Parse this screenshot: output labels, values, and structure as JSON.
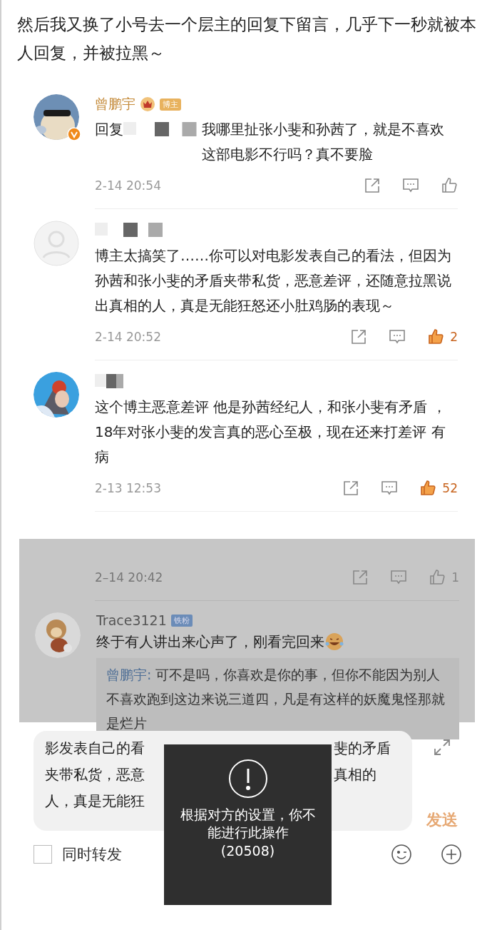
{
  "intro": "然后我又换了小号去一个层主的回复下留言，几乎下一秒就被本人回复，并被拉黑～",
  "screenshot_1": {
    "comments": [
      {
        "author": "曾鹏宇",
        "verified": true,
        "badge": "博主",
        "reply_prefix": "回复",
        "text": "我哪里扯张小斐和孙茜了，就是不喜欢这部电影不行吗？真不要脸",
        "time": "2-14 20:54",
        "liked": false
      },
      {
        "text": "博主太搞笑了……你可以对电影发表自己的看法，但因为孙茜和张小斐的矛盾夹带私货，恶意差评，还随意拉黑说出真相的人，真是无能狂怒还小肚鸡肠的表现～",
        "time": "2-14 20:52",
        "liked": true,
        "likes": "2"
      },
      {
        "text": "这个博主恶意差评 他是孙茜经纪人，和张小斐有矛盾 ，18年对张小斐的发言真的恶心至极，现在还来打差评 有病",
        "time": "2-13 12:53",
        "liked": true,
        "likes": "52"
      }
    ]
  },
  "screenshot_2": {
    "partial_comment": {
      "time": "2–14 20:42",
      "liked": false,
      "likes": "1"
    },
    "comment": {
      "author": "Trace3121",
      "badge": "铁粉",
      "text": "终于有人讲出来心声了，刚看完回来",
      "reply": {
        "author": "曾鹏宇:",
        "text": "可不是吗，你喜欢是你的事，但你不能因为别人不喜欢跑到这边来说三道四，凡是有这样的妖魔鬼怪那就是烂片"
      }
    },
    "composer": {
      "lines": [
        {
          "left": "影发表自己的看",
          "right": "斐的矛盾"
        },
        {
          "left": "夹带私货，恶意",
          "right": "真相的"
        },
        {
          "left": "人，真是无能狂"
        }
      ],
      "send": "发送",
      "forward": {
        "label": "同时转发",
        "checked": false
      }
    },
    "toast": {
      "message": "根据对方的设置，你不能进行此操作",
      "code": "(20508)"
    }
  }
}
